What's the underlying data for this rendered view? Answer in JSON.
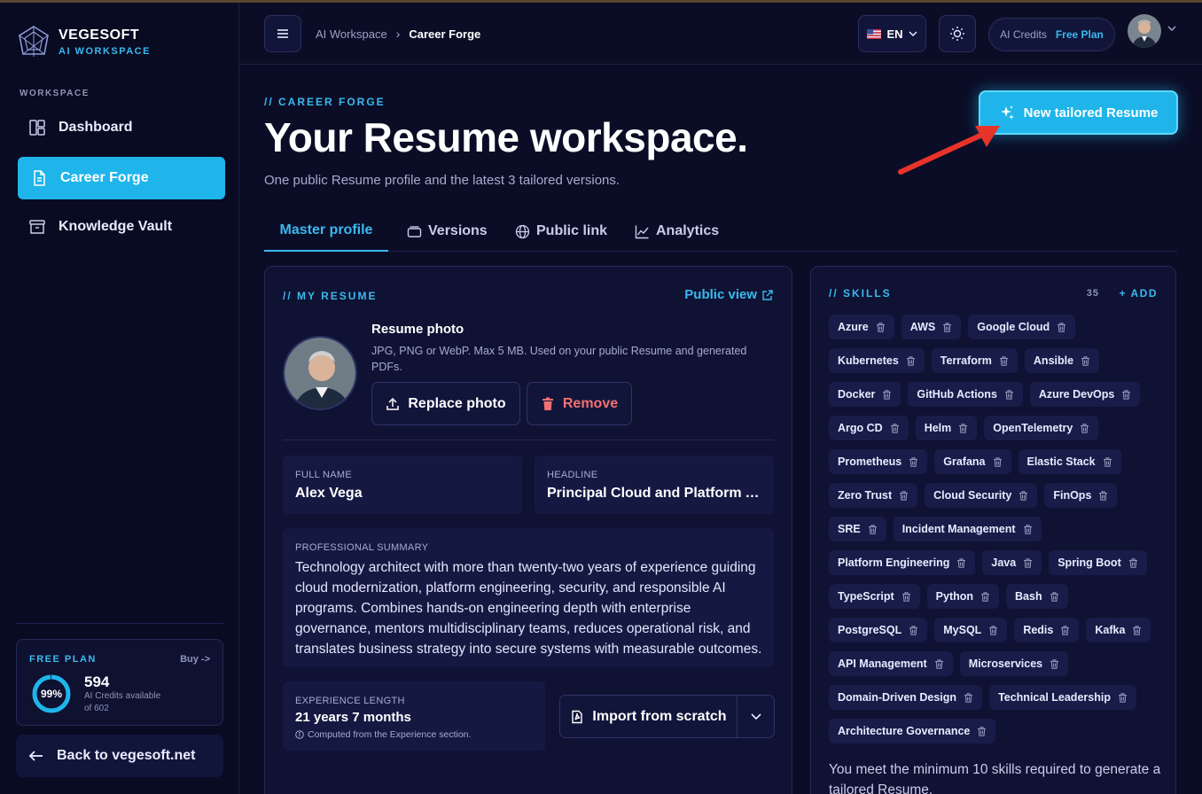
{
  "brand": {
    "name": "VEGESOFT",
    "sub": "AI WORKSPACE"
  },
  "sidebar": {
    "section_label": "WORKSPACE",
    "items": [
      {
        "label": "Dashboard",
        "icon": "dashboard-icon"
      },
      {
        "label": "Career Forge",
        "icon": "document-icon",
        "active": true
      },
      {
        "label": "Knowledge Vault",
        "icon": "archive-icon"
      }
    ],
    "plan": {
      "title": "FREE PLAN",
      "buy_label": "Buy ->",
      "percent_label": "99%",
      "percent": 0.99,
      "credits": "594",
      "credits_line1": "AI Credits available",
      "credits_line2": "of 602"
    },
    "back_label": "Back to vegesoft.net"
  },
  "header": {
    "breadcrumb_root": "AI Workspace",
    "breadcrumb_current": "Career Forge",
    "language": "EN",
    "credits_label": "AI Credits",
    "plan_label": "Free Plan"
  },
  "page": {
    "eyebrow": "// CAREER FORGE",
    "title": "Your Resume workspace.",
    "subtitle": "One public Resume profile and the latest 3 tailored versions.",
    "new_button": "New tailored Resume"
  },
  "tabs": [
    {
      "label": "Master profile",
      "active": true
    },
    {
      "label": "Versions"
    },
    {
      "label": "Public link"
    },
    {
      "label": "Analytics"
    }
  ],
  "resume": {
    "eyebrow": "// MY RESUME",
    "public_view": "Public view",
    "photo_title": "Resume photo",
    "photo_desc": "JPG, PNG or WebP. Max 5 MB. Used on your public Resume and generated PDFs.",
    "replace_label": "Replace photo",
    "remove_label": "Remove",
    "full_name_label": "FULL NAME",
    "full_name": "Alex Vega",
    "headline_label": "HEADLINE",
    "headline": "Principal Cloud and Platform A...",
    "summary_label": "PROFESSIONAL SUMMARY",
    "summary": "Technology architect with more than twenty-two years of experience guiding cloud modernization, platform engineering, security, and responsible AI programs. Combines hands-on engineering depth with enterprise governance, mentors multidisciplinary teams, reduces operational risk, and translates business strategy into secure systems with measurable outcomes.",
    "experience_label": "EXPERIENCE LENGTH",
    "experience": "21 years 7 months",
    "experience_note": "Computed from the Experience section.",
    "import_label": "Import from scratch"
  },
  "skills": {
    "eyebrow": "// SKILLS",
    "count": "35",
    "add_label": "+ ADD",
    "items": [
      "Azure",
      "AWS",
      "Google Cloud",
      "Kubernetes",
      "Terraform",
      "Ansible",
      "Docker",
      "GitHub Actions",
      "Azure DevOps",
      "Argo CD",
      "Helm",
      "OpenTelemetry",
      "Prometheus",
      "Grafana",
      "Elastic Stack",
      "Zero Trust",
      "Cloud Security",
      "FinOps",
      "SRE",
      "Incident Management",
      "Platform Engineering",
      "Java",
      "Spring Boot",
      "TypeScript",
      "Python",
      "Bash",
      "PostgreSQL",
      "MySQL",
      "Redis",
      "Kafka",
      "API Management",
      "Microservices",
      "Domain-Driven Design",
      "Technical Leadership",
      "Architecture Governance"
    ],
    "note": "You meet the minimum 10 skills required to generate a tailored Resume."
  },
  "colors": {
    "accent": "#1fb5ea",
    "danger": "#f27272",
    "background": "#0b0d26"
  }
}
